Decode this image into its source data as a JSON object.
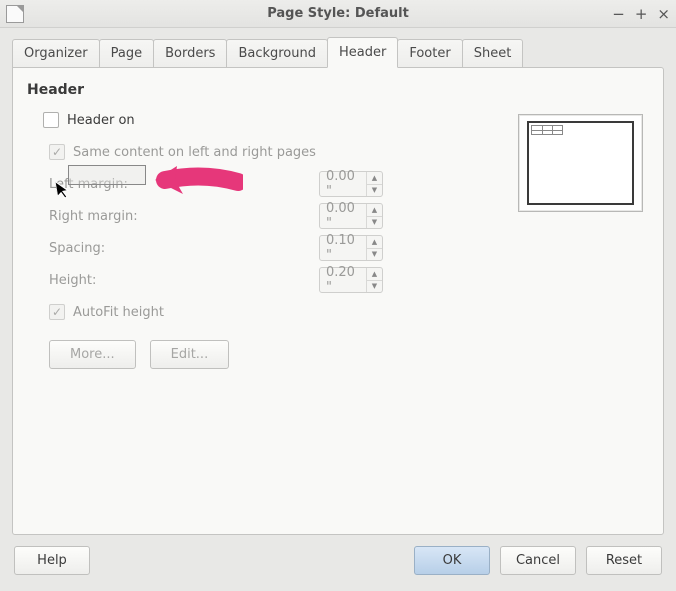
{
  "window": {
    "title": "Page Style: Default"
  },
  "tabs": {
    "organizer": "Organizer",
    "page": "Page",
    "borders": "Borders",
    "background": "Background",
    "header": "Header",
    "footer": "Footer",
    "sheet": "Sheet"
  },
  "header": {
    "section_title": "Header",
    "header_on": {
      "label": "Header on",
      "checked": false
    },
    "same_content": {
      "label": "Same content on left and right pages",
      "checked": true
    },
    "left_margin": {
      "label": "Left margin:",
      "value": "0.00 \""
    },
    "right_margin": {
      "label": "Right margin:",
      "value": "0.00 \""
    },
    "spacing": {
      "label": "Spacing:",
      "value": "0.10 \""
    },
    "height": {
      "label": "Height:",
      "value": "0.20 \""
    },
    "autofit": {
      "label": "AutoFit height",
      "checked": true
    },
    "more_btn": "More...",
    "edit_btn": "Edit..."
  },
  "footer": {
    "help": "Help",
    "ok": "OK",
    "cancel": "Cancel",
    "reset": "Reset"
  }
}
